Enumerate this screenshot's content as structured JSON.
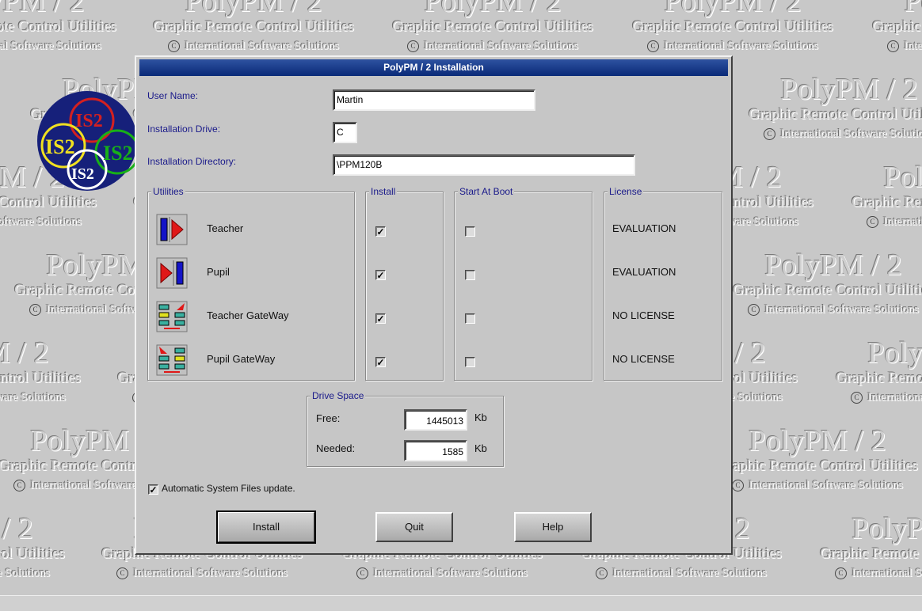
{
  "wallpaper": {
    "title": "PolyPM / 2",
    "subtitle": "Graphic Remote Control Utilities",
    "copyright": "International Software Solutions"
  },
  "logo": {
    "text": "IS2",
    "colors": [
      "#d42020",
      "#f0e020",
      "#18b018",
      "#ffffff"
    ]
  },
  "dialog": {
    "title": "PolyPM / 2 Installation",
    "user_name_label": "User Name:",
    "user_name_value": "Martin",
    "drive_label": "Installation Drive:",
    "drive_value": "C",
    "directory_label": "Installation Directory:",
    "directory_value": "\\PPM120B",
    "groups": {
      "utilities": "Utilities",
      "install": "Install",
      "boot": "Start At Boot",
      "license": "License"
    },
    "utilities": [
      {
        "label": "Teacher",
        "icon": "teacher-icon",
        "install": true,
        "boot": false,
        "license": "EVALUATION"
      },
      {
        "label": "Pupil",
        "icon": "pupil-icon",
        "install": true,
        "boot": false,
        "license": "EVALUATION"
      },
      {
        "label": "Teacher GateWay",
        "icon": "teacher-gateway-icon",
        "install": true,
        "boot": false,
        "license": "NO LICENSE"
      },
      {
        "label": "Pupil GateWay",
        "icon": "pupil-gateway-icon",
        "install": true,
        "boot": false,
        "license": "NO LICENSE"
      }
    ],
    "drive_space": {
      "title": "Drive Space",
      "free_label": "Free:",
      "free_value": "1445013",
      "needed_label": "Needed:",
      "needed_value": "1585",
      "unit": "Kb"
    },
    "auto_update_label": "Automatic System Files update.",
    "auto_update_checked": true,
    "buttons": {
      "install": "Install",
      "quit": "Quit",
      "help": "Help"
    }
  },
  "check_mark": "✓"
}
